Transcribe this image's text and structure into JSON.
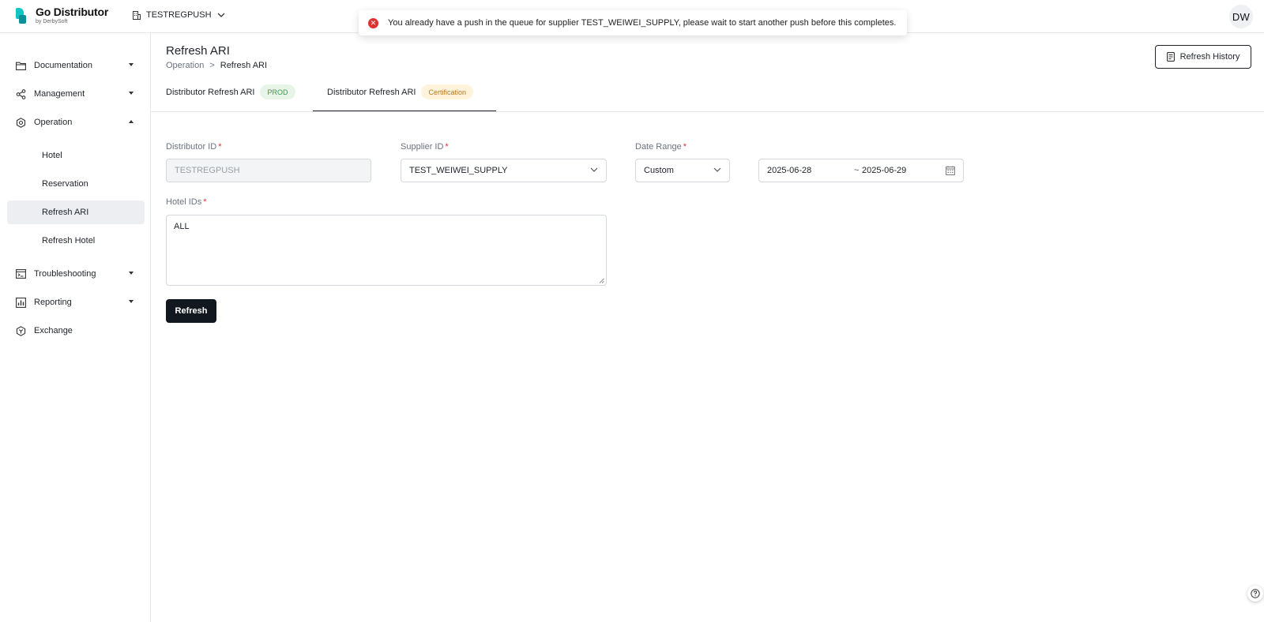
{
  "app": {
    "title": "Go Distributor",
    "subtitle": "by DerbySoft"
  },
  "org": {
    "name": "TESTREGPUSH"
  },
  "user": {
    "initials": "DW"
  },
  "toast": {
    "type": "error",
    "message": "You already have a push in the queue for supplier TEST_WEIWEI_SUPPLY, please wait to start another push before this completes."
  },
  "sidebar": {
    "items": [
      {
        "label": "Documentation",
        "icon": "folder-icon",
        "expanded": false
      },
      {
        "label": "Management",
        "icon": "share-icon",
        "expanded": false
      },
      {
        "label": "Operation",
        "icon": "gear-icon",
        "expanded": true
      },
      {
        "label": "Troubleshooting",
        "icon": "terminal-icon",
        "expanded": false
      },
      {
        "label": "Reporting",
        "icon": "bar-chart-icon",
        "expanded": false
      },
      {
        "label": "Exchange",
        "icon": "exchange-icon"
      }
    ],
    "operation_children": [
      "Hotel",
      "Reservation",
      "Refresh ARI",
      "Refresh Hotel"
    ],
    "active_child": "Refresh ARI"
  },
  "page": {
    "title": "Refresh ARI",
    "breadcrumb": [
      "Operation",
      "Refresh ARI"
    ],
    "breadcrumb_sep": ">",
    "history_button": "Refresh History"
  },
  "tabs": [
    {
      "label": "Distributor Refresh ARI",
      "badge": "PROD",
      "badge_bg": "#e7f5e9",
      "badge_color": "#3a9b4c",
      "active": false
    },
    {
      "label": "Distributor Refresh ARI",
      "badge": "Certification",
      "badge_bg": "#fff3dc",
      "badge_color": "#b7791f",
      "active": true
    }
  ],
  "form": {
    "distributor_id": {
      "label": "Distributor ID",
      "value": "TESTREGPUSH",
      "required_mark": "*"
    },
    "supplier_id": {
      "label": "Supplier ID",
      "value": "TEST_WEIWEI_SUPPLY",
      "required_mark": "*"
    },
    "date_range": {
      "label": "Date Range",
      "mode": "Custom",
      "start": "2025-06-28",
      "end": "2025-06-29",
      "separator": "~",
      "required_mark": "*"
    },
    "hotel_ids": {
      "label": "Hotel IDs",
      "value": "ALL",
      "required_mark": "*"
    },
    "submit_label": "Refresh"
  },
  "colors": {
    "accent": "#111820",
    "error": "#e03131",
    "brand": "#14c3c3"
  }
}
